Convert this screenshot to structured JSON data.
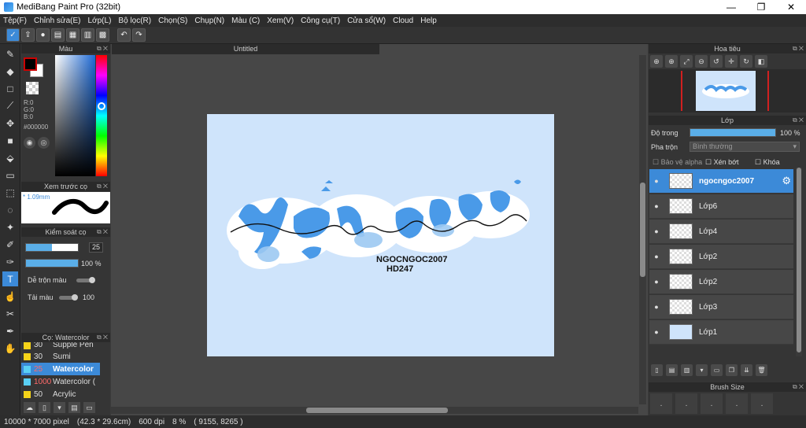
{
  "window": {
    "title": "MediBang Paint Pro (32bit)",
    "controls": [
      "—",
      "❐",
      "✕"
    ]
  },
  "menu": [
    "Tệp(F)",
    "Chỉnh sửa(E)",
    "Lớp(L)",
    "Bộ lọc(R)",
    "Chọn(S)",
    "Chụp(N)",
    "Màu (C)",
    "Xem(V)",
    "Công cụ(T)",
    "Cửa sổ(W)",
    "Cloud",
    "Help"
  ],
  "color_panel": {
    "title": "Màu",
    "r": "R:0",
    "g": "G:0",
    "b": "B:0",
    "hex": "#000000"
  },
  "preview_panel": {
    "title": "Xem trước cọ",
    "size": "* 1.09mm"
  },
  "brush_control": {
    "title": "Kiểm soát cọ",
    "size_value": "25",
    "opacity_value": "100 %",
    "opacity_fill": 1.0,
    "size_fill": 0.5,
    "mix_label": "Dễ trộn màu",
    "mix_value": "0",
    "load_label": "Tải màu",
    "load_value": "100"
  },
  "brush_panel": {
    "title": "Cọ: Watercolor",
    "items": [
      {
        "num": "30",
        "name": "Supple Pen"
      },
      {
        "num": "30",
        "name": "Sumi"
      },
      {
        "num": "25",
        "name": "Watercolor"
      },
      {
        "num": "1000",
        "name": "Watercolor ("
      },
      {
        "num": "50",
        "name": "Acrylic"
      }
    ]
  },
  "document": {
    "tab": "Untitled",
    "art_text_main": "Yên nhi",
    "art_text_script": "yeu nem nhi",
    "art_caption1": "NGOCNGOC2007",
    "art_caption2": "HD247"
  },
  "navigator": {
    "title": "Hoa tiêu"
  },
  "layers": {
    "title": "Lớp",
    "opacity_label": "Độ trong",
    "opacity_value": "100 %",
    "blend_label": "Pha trộn",
    "blend_value": "Bình thường",
    "protect_alpha": "Bảo vệ alpha",
    "clipping": "Xén bớt",
    "lock": "Khóa",
    "items": [
      {
        "name": "ngocngoc2007",
        "selected": true
      },
      {
        "name": "Lớp6",
        "selected": false
      },
      {
        "name": "Lớp4",
        "selected": false
      },
      {
        "name": "Lớp2",
        "selected": false
      },
      {
        "name": "Lớp2",
        "selected": false
      },
      {
        "name": "Lớp3",
        "selected": false
      },
      {
        "name": "Lớp1",
        "selected": false
      }
    ]
  },
  "brush_size": {
    "title": "Brush Size",
    "cells": [
      ".",
      ".",
      ".",
      ".",
      "."
    ]
  },
  "status": {
    "pixels": "10000 * 7000 pixel",
    "cm": "(42.3 * 29.6cm)",
    "dpi": "600 dpi",
    "zoom": "8 %",
    "coords": "( 9155, 8265 )"
  },
  "colors": {
    "accent": "#3c8ad8",
    "canvas_bg": "#cfe4fb",
    "letter_blue": "#4a9ae8"
  }
}
